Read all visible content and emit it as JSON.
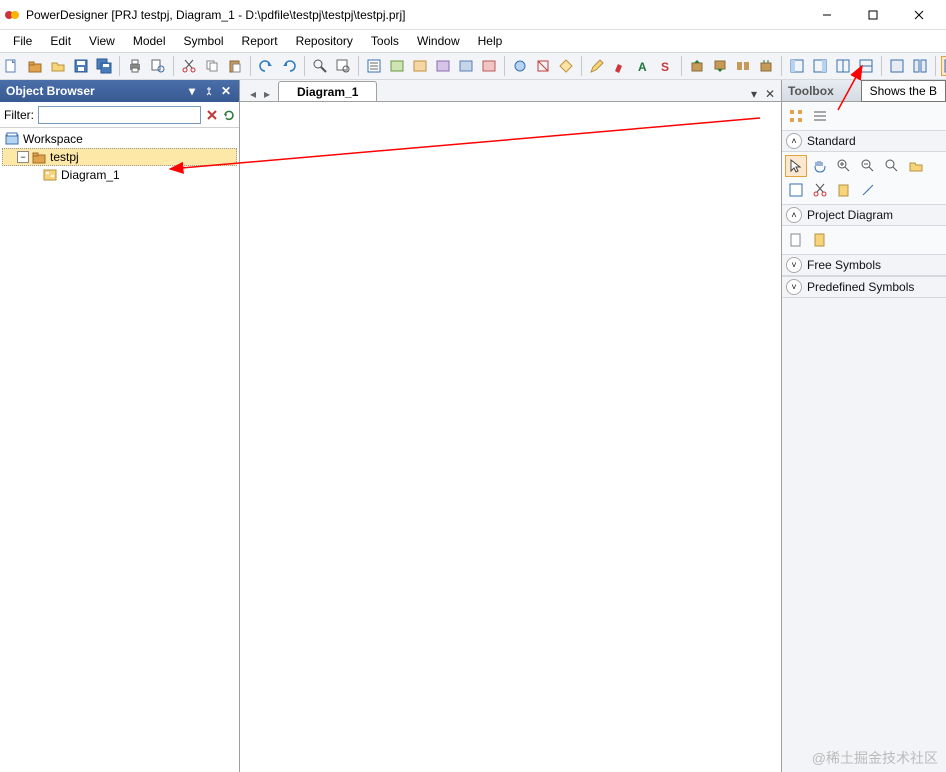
{
  "title": "PowerDesigner [PRJ testpj, Diagram_1 - D:\\pdfile\\testpj\\testpj\\testpj.prj]",
  "menus": [
    "File",
    "Edit",
    "View",
    "Model",
    "Symbol",
    "Report",
    "Repository",
    "Tools",
    "Window",
    "Help"
  ],
  "browser": {
    "title": "Object Browser",
    "filter_label": "Filter:",
    "filter_value": "",
    "tree": {
      "root": "Workspace",
      "project": "testpj",
      "diagram": "Diagram_1"
    }
  },
  "tabs": {
    "active": "Diagram_1"
  },
  "toolbox": {
    "title": "Toolbox",
    "sections": {
      "standard": "Standard",
      "project": "Project Diagram",
      "free": "Free Symbols",
      "predef": "Predefined Symbols"
    }
  },
  "tooltip": "Shows the B",
  "watermark": "@稀土掘金技术社区"
}
